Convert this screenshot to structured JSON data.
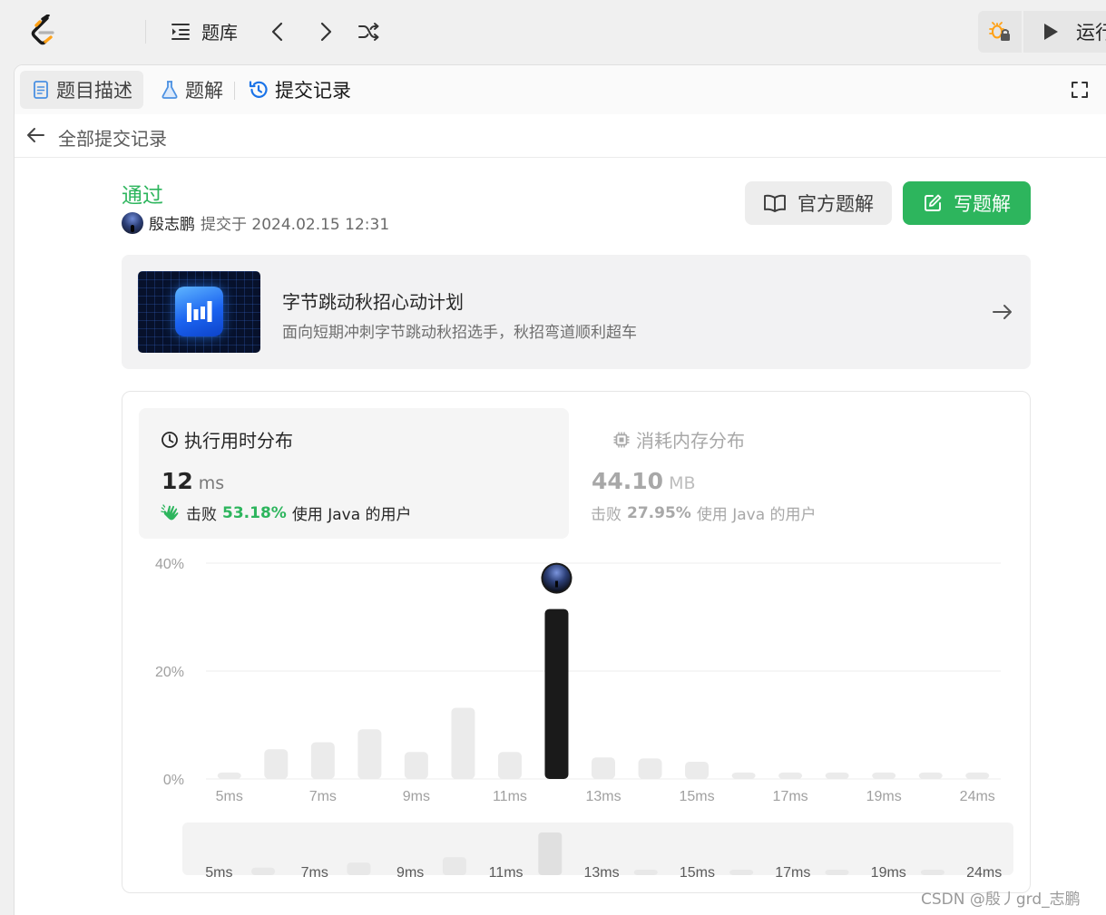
{
  "nav": {
    "problem_list_label": "题库",
    "run_label": "运行"
  },
  "tabs": [
    {
      "label": "题目描述"
    },
    {
      "label": "题解"
    },
    {
      "label": "提交记录"
    }
  ],
  "back": {
    "label": "全部提交记录"
  },
  "submission": {
    "status": "通过",
    "author": "殷志鹏",
    "submitted_at": "提交于 2024.02.15 12:31",
    "official_solution_label": "官方题解",
    "write_solution_label": "写题解"
  },
  "banner": {
    "title": "字节跳动秋招心动计划",
    "subtitle": "面向短期冲刺字节跳动秋招选手，秋招弯道顺利超车"
  },
  "runtime": {
    "title": "执行用时分布",
    "value": "12",
    "unit": "ms",
    "beat_prefix": "击败",
    "beat_pct": "53.18%",
    "beat_suffix": "使用 Java 的用户"
  },
  "memory": {
    "title": "消耗内存分布",
    "value": "44.10",
    "unit": "MB",
    "beat_prefix": "击败",
    "beat_pct": "27.95%",
    "beat_suffix": "使用 Java 的用户"
  },
  "chart_data": {
    "type": "bar",
    "ylabel": "",
    "xlabel": "",
    "yticks": [
      "0%",
      "20%",
      "40%"
    ],
    "ylim": [
      0,
      40
    ],
    "grid": true,
    "categories": [
      "5ms",
      "6ms",
      "7ms",
      "8ms",
      "9ms",
      "10ms",
      "11ms",
      "12ms",
      "13ms",
      "14ms",
      "15ms",
      "16ms",
      "17ms",
      "18ms",
      "19ms",
      "20ms",
      "24ms"
    ],
    "xtick_labels": [
      "5ms",
      "7ms",
      "9ms",
      "11ms",
      "13ms",
      "15ms",
      "17ms",
      "19ms",
      "24ms"
    ],
    "values": [
      1.2,
      5.5,
      6.8,
      9.2,
      5.0,
      13.2,
      5.0,
      31.5,
      4.0,
      3.8,
      3.2,
      1.2,
      1.2,
      1.2,
      1.2,
      1.2,
      1.2
    ],
    "highlight_category": "12ms",
    "colors": {
      "bar": "#ebebeb",
      "highlight": "#1a1a1a",
      "grid": "#ececec",
      "tick": "#a0a0a0"
    },
    "overview": {
      "labels": [
        "5ms",
        "7ms",
        "9ms",
        "11ms",
        "13ms",
        "15ms",
        "17ms",
        "19ms",
        "24ms"
      ]
    }
  },
  "watermark": "CSDN @殷丿grd_志鹏"
}
